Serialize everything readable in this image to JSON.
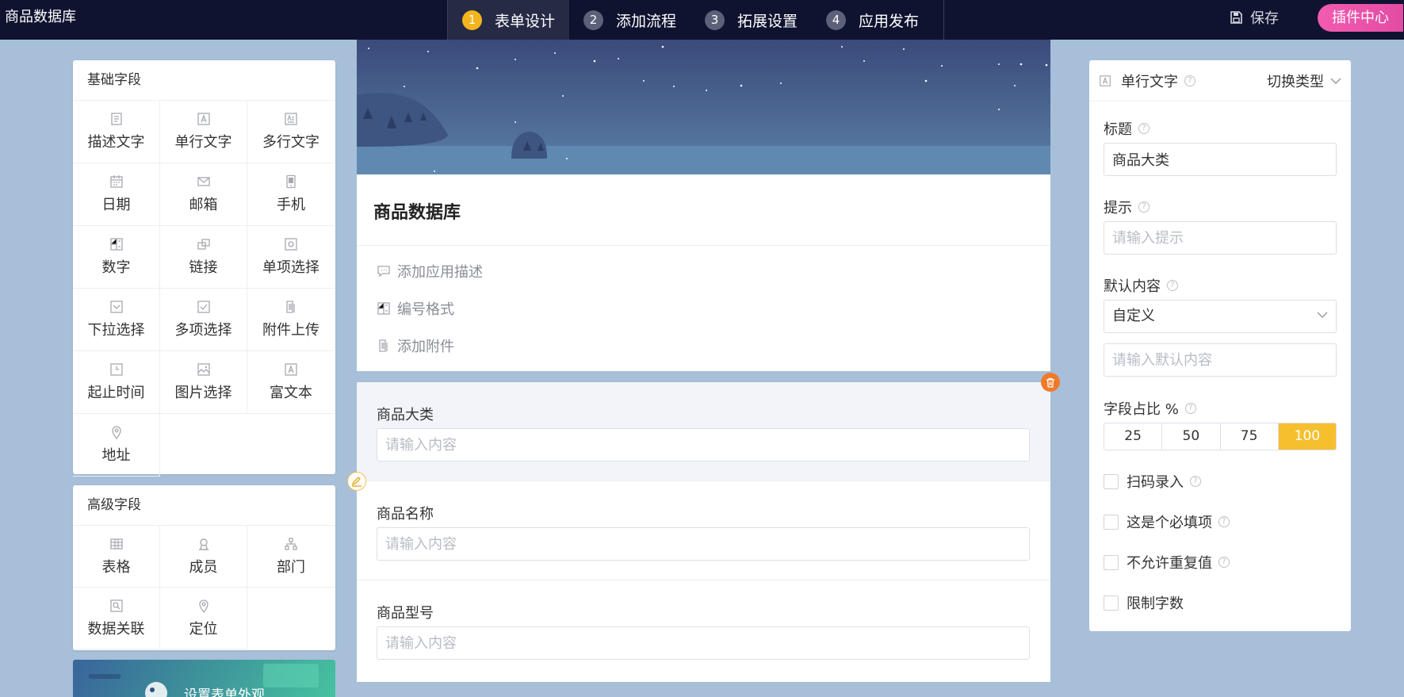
{
  "app": {
    "title": "商品数据库"
  },
  "steps": [
    {
      "num": "1",
      "label": "表单设计"
    },
    {
      "num": "2",
      "label": "添加流程"
    },
    {
      "num": "3",
      "label": "拓展设置"
    },
    {
      "num": "4",
      "label": "应用发布"
    }
  ],
  "toolbar": {
    "save_label": "保存",
    "plugin_label": "插件中心"
  },
  "basic_fields": {
    "title": "基础字段",
    "items": [
      {
        "label": "描述文字",
        "icon": "description-icon"
      },
      {
        "label": "单行文字",
        "icon": "single-line-text-icon"
      },
      {
        "label": "多行文字",
        "icon": "multi-line-text-icon"
      },
      {
        "label": "日期",
        "icon": "calendar-icon"
      },
      {
        "label": "邮箱",
        "icon": "mail-icon"
      },
      {
        "label": "手机",
        "icon": "phone-icon"
      },
      {
        "label": "数字",
        "icon": "number-icon"
      },
      {
        "label": "链接",
        "icon": "link-icon"
      },
      {
        "label": "单项选择",
        "icon": "radio-icon"
      },
      {
        "label": "下拉选择",
        "icon": "dropdown-icon"
      },
      {
        "label": "多项选择",
        "icon": "checkbox-icon"
      },
      {
        "label": "附件上传",
        "icon": "attachment-icon"
      },
      {
        "label": "起止时间",
        "icon": "time-range-icon"
      },
      {
        "label": "图片选择",
        "icon": "image-icon"
      },
      {
        "label": "富文本",
        "icon": "rich-text-icon"
      },
      {
        "label": "地址",
        "icon": "location-pin-icon"
      }
    ]
  },
  "advanced_fields": {
    "title": "高级字段",
    "items": [
      {
        "label": "表格",
        "icon": "table-icon"
      },
      {
        "label": "成员",
        "icon": "member-icon"
      },
      {
        "label": "部门",
        "icon": "department-icon"
      },
      {
        "label": "数据关联",
        "icon": "data-link-icon"
      },
      {
        "label": "定位",
        "icon": "location-pin-icon"
      }
    ]
  },
  "banner": {
    "text": "设置表单外观"
  },
  "form": {
    "title": "商品数据库",
    "actions": [
      {
        "label": "添加应用描述",
        "icon": "comment-icon"
      },
      {
        "label": "编号格式",
        "icon": "number-format-icon"
      },
      {
        "label": "添加附件",
        "icon": "attachment-icon"
      }
    ],
    "fields": [
      {
        "label": "商品大类",
        "placeholder": "请输入内容"
      },
      {
        "label": "商品名称",
        "placeholder": "请输入内容"
      },
      {
        "label": "商品型号",
        "placeholder": "请输入内容"
      }
    ]
  },
  "props": {
    "type_label": "单行文字",
    "switch_label": "切换类型",
    "title_label": "标题",
    "title_value": "商品大类",
    "hint_label": "提示",
    "hint_placeholder": "请输入提示",
    "default_label": "默认内容",
    "default_select": "自定义",
    "default_placeholder": "请输入默认内容",
    "ratio_label": "字段占比 %",
    "ratio_options": [
      "25",
      "50",
      "75",
      "100"
    ],
    "ratio_selected": "100",
    "checks": [
      {
        "label": "扫码录入",
        "help": true
      },
      {
        "label": "这是个必填项",
        "help": true
      },
      {
        "label": "不允许重复值",
        "help": true
      },
      {
        "label": "限制字数",
        "help": false
      }
    ]
  },
  "colors": {
    "topbar": "#0f1330",
    "accent_yellow": "#f5bf2e",
    "plugin_pink": "#f25bb0",
    "delete_orange": "#f07a2a",
    "page_bg": "#a7bfd8"
  }
}
